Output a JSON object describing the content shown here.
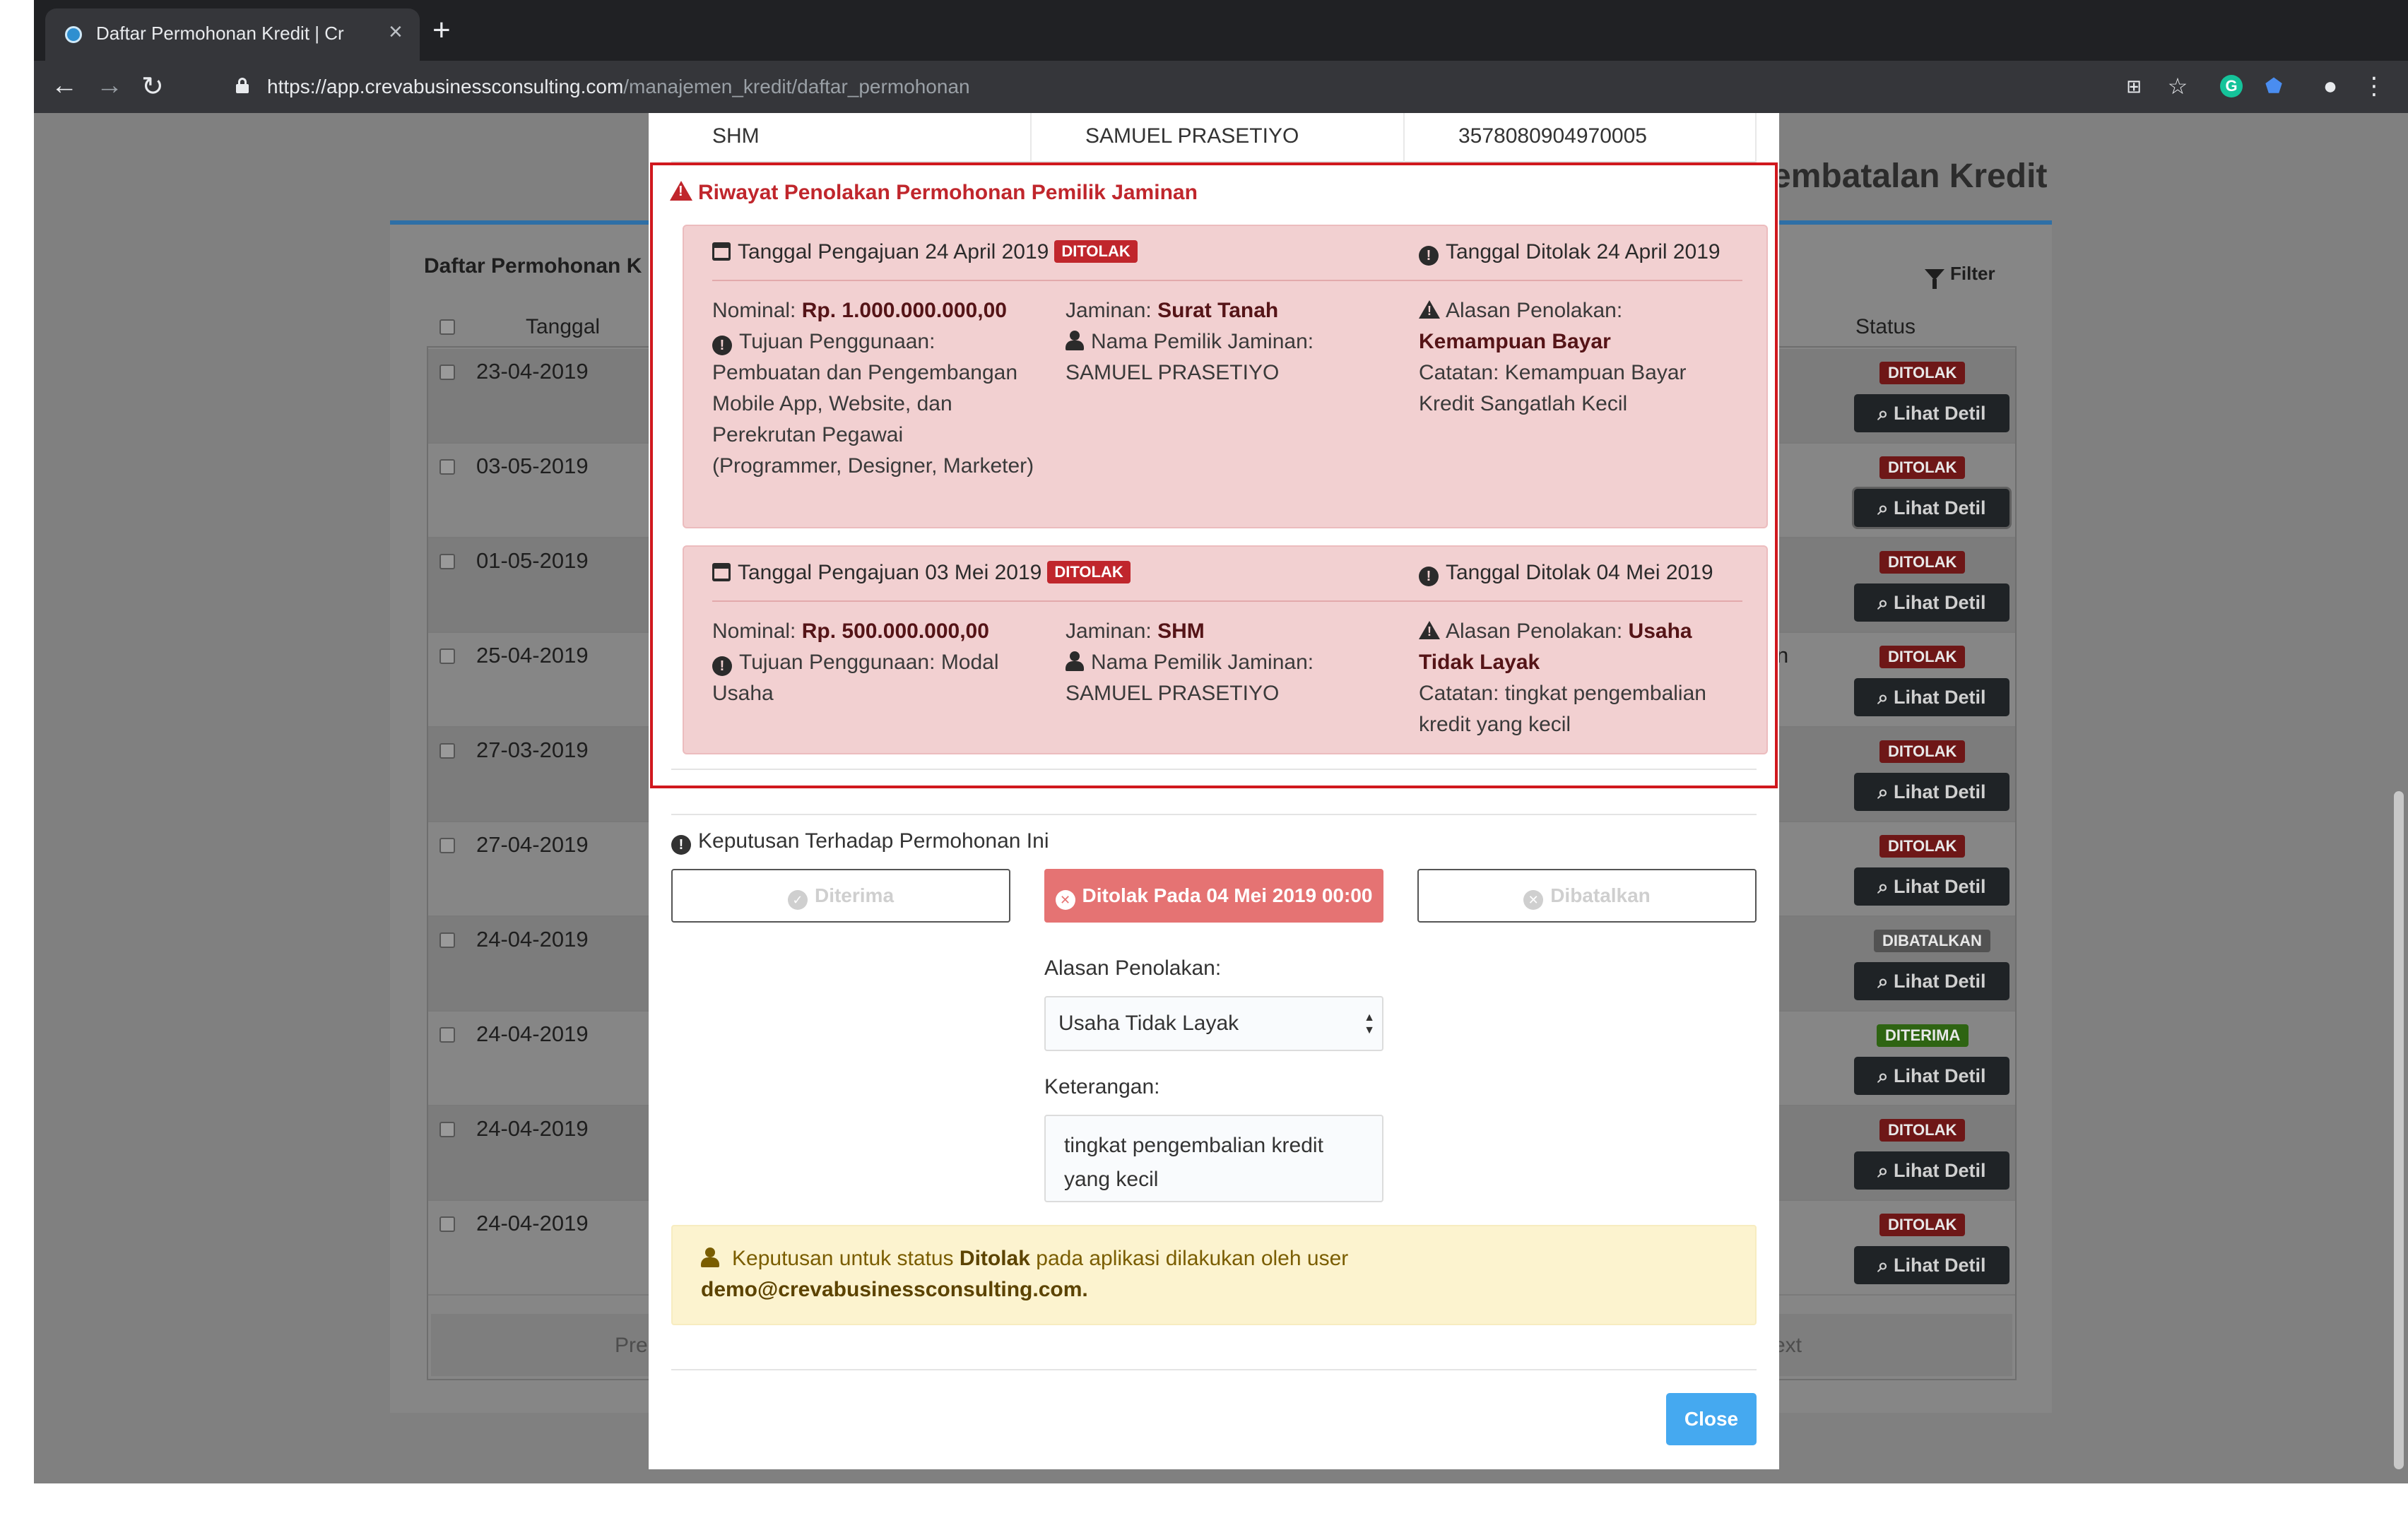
{
  "browser": {
    "tab_title": "Daftar Permohonan Kredit | Cr",
    "url_host": "https://app.crevabusinessconsulting.com",
    "url_path": "/manajemen_kredit/daftar_permohonan"
  },
  "background": {
    "page_heading": "embatalan Kredit",
    "panel_title": "Daftar Permohonan K",
    "filter_label": "Filter",
    "col_tanggal": "Tanggal",
    "col_status": "Status",
    "detail_label": "Lihat Detil",
    "mid_fragment": "n",
    "prev": "Pre",
    "next": "ext",
    "rows": [
      {
        "date": "23-04-2019",
        "status": "DITOLAK",
        "kind": "red"
      },
      {
        "date": "03-05-2019",
        "status": "DITOLAK",
        "kind": "red"
      },
      {
        "date": "01-05-2019",
        "status": "DITOLAK",
        "kind": "red"
      },
      {
        "date": "25-04-2019",
        "status": "DITOLAK",
        "kind": "red"
      },
      {
        "date": "27-03-2019",
        "status": "DITOLAK",
        "kind": "red"
      },
      {
        "date": "27-04-2019",
        "status": "DITOLAK",
        "kind": "red"
      },
      {
        "date": "24-04-2019",
        "status": "DIBATALKAN",
        "kind": "grey"
      },
      {
        "date": "24-04-2019",
        "status": "DITERIMA",
        "kind": "green"
      },
      {
        "date": "24-04-2019",
        "status": "DITOLAK",
        "kind": "red"
      },
      {
        "date": "24-04-2019",
        "status": "DITOLAK",
        "kind": "red"
      }
    ]
  },
  "modal": {
    "top_row": {
      "c1": "SHM",
      "c2": "SAMUEL PRASETIYO",
      "c3": "3578080904970005"
    },
    "riwayat_title": "Riwayat Penolakan Permohonan Pemilik Jaminan",
    "cards": [
      {
        "tanggal_pengajuan": "Tanggal Pengajuan 24 April 2019",
        "badge": "DITOLAK",
        "tanggal_ditolak": "Tanggal Ditolak 24 April 2019",
        "nominal_label": "Nominal:",
        "nominal": "Rp. 1.000.000.000,00",
        "tujuan_label": "Tujuan Penggunaan:",
        "tujuan": "Pembuatan dan Pengembangan Mobile App, Website, dan Perekrutan Pegawai (Programmer, Designer, Marketer)",
        "jaminan_label": "Jaminan:",
        "jaminan": "Surat Tanah",
        "pemilik_label": "Nama Pemilik Jaminan:",
        "pemilik": "SAMUEL PRASETIYO",
        "alasan_label": "Alasan Penolakan:",
        "alasan": "Kemampuan Bayar",
        "catatan": "Catatan: Kemampuan Bayar Kredit Sangatlah Kecil"
      },
      {
        "tanggal_pengajuan": "Tanggal Pengajuan 03 Mei 2019",
        "badge": "DITOLAK",
        "tanggal_ditolak": "Tanggal Ditolak 04 Mei 2019",
        "nominal_label": "Nominal:",
        "nominal": "Rp. 500.000.000,00",
        "tujuan_label": "Tujuan Penggunaan:",
        "tujuan": "Modal Usaha",
        "jaminan_label": "Jaminan:",
        "jaminan": "SHM",
        "pemilik_label": "Nama Pemilik Jaminan:",
        "pemilik": "SAMUEL PRASETIYO",
        "alasan_label": "Alasan Penolakan:",
        "alasan": "Usaha Tidak Layak",
        "catatan": "Catatan: tingkat pengembalian kredit yang kecil"
      }
    ],
    "keputusan_title": "Keputusan Terhadap Permohonan Ini",
    "btn_diterima": "Diterima",
    "btn_ditolak": "Ditolak Pada 04 Mei 2019 00:00",
    "btn_dibatalkan": "Dibatalkan",
    "alasan_label": "Alasan Penolakan:",
    "alasan_value": "Usaha Tidak Layak",
    "keterangan_label": "Keterangan:",
    "keterangan_value": "tingkat pengembalian kredit yang kecil",
    "alert_prefix": "Keputusan untuk status",
    "alert_status": "Ditolak",
    "alert_mid": "pada aplikasi dilakukan oleh user",
    "alert_user": "demo@crevabusinessconsulting.com.",
    "close_label": "Close"
  }
}
